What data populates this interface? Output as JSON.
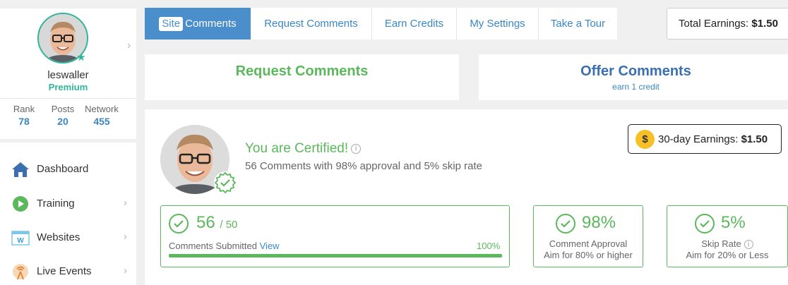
{
  "profile": {
    "username": "leswaller",
    "membership": "Premium",
    "stats": [
      {
        "label": "Rank",
        "value": "78"
      },
      {
        "label": "Posts",
        "value": "20"
      },
      {
        "label": "Network",
        "value": "455"
      }
    ]
  },
  "nav": {
    "items": [
      {
        "label": "Dashboard",
        "icon": "home-icon"
      },
      {
        "label": "Training",
        "icon": "play-icon"
      },
      {
        "label": "Websites",
        "icon": "website-icon"
      },
      {
        "label": "Live Events",
        "icon": "broadcast-icon"
      }
    ]
  },
  "tabs": {
    "active_chip": "Site",
    "items": [
      {
        "label": "Comments"
      },
      {
        "label": "Request Comments"
      },
      {
        "label": "Earn Credits"
      },
      {
        "label": "My Settings"
      },
      {
        "label": "Take a Tour"
      }
    ]
  },
  "total_earnings": {
    "label": "Total Earnings:",
    "value": "$1.50"
  },
  "panels": {
    "request": {
      "title": "Request Comments"
    },
    "offer": {
      "title": "Offer Comments",
      "subtitle": "earn 1 credit"
    }
  },
  "certified": {
    "title": "You are Certified!",
    "description": "56 Comments with 98% approval and 5% skip rate",
    "thirty_day": {
      "coin": "$",
      "label": "30-day Earnings:",
      "value": "$1.50"
    }
  },
  "metrics": {
    "comments": {
      "value": "56",
      "target": "/ 50",
      "label": "Comments Submitted",
      "link": "View",
      "percent_text": "100%",
      "progress": 100
    },
    "approval": {
      "value": "98%",
      "label": "Comment Approval",
      "sub": "Aim for 80% or higher"
    },
    "skip": {
      "value": "5%",
      "label": "Skip Rate",
      "sub": "Aim for 20% or Less"
    }
  },
  "colors": {
    "accent_blue": "#4a8ecb",
    "success_green": "#5cb85c",
    "teal": "#2fb59a",
    "coin_gold": "#f6c026"
  }
}
